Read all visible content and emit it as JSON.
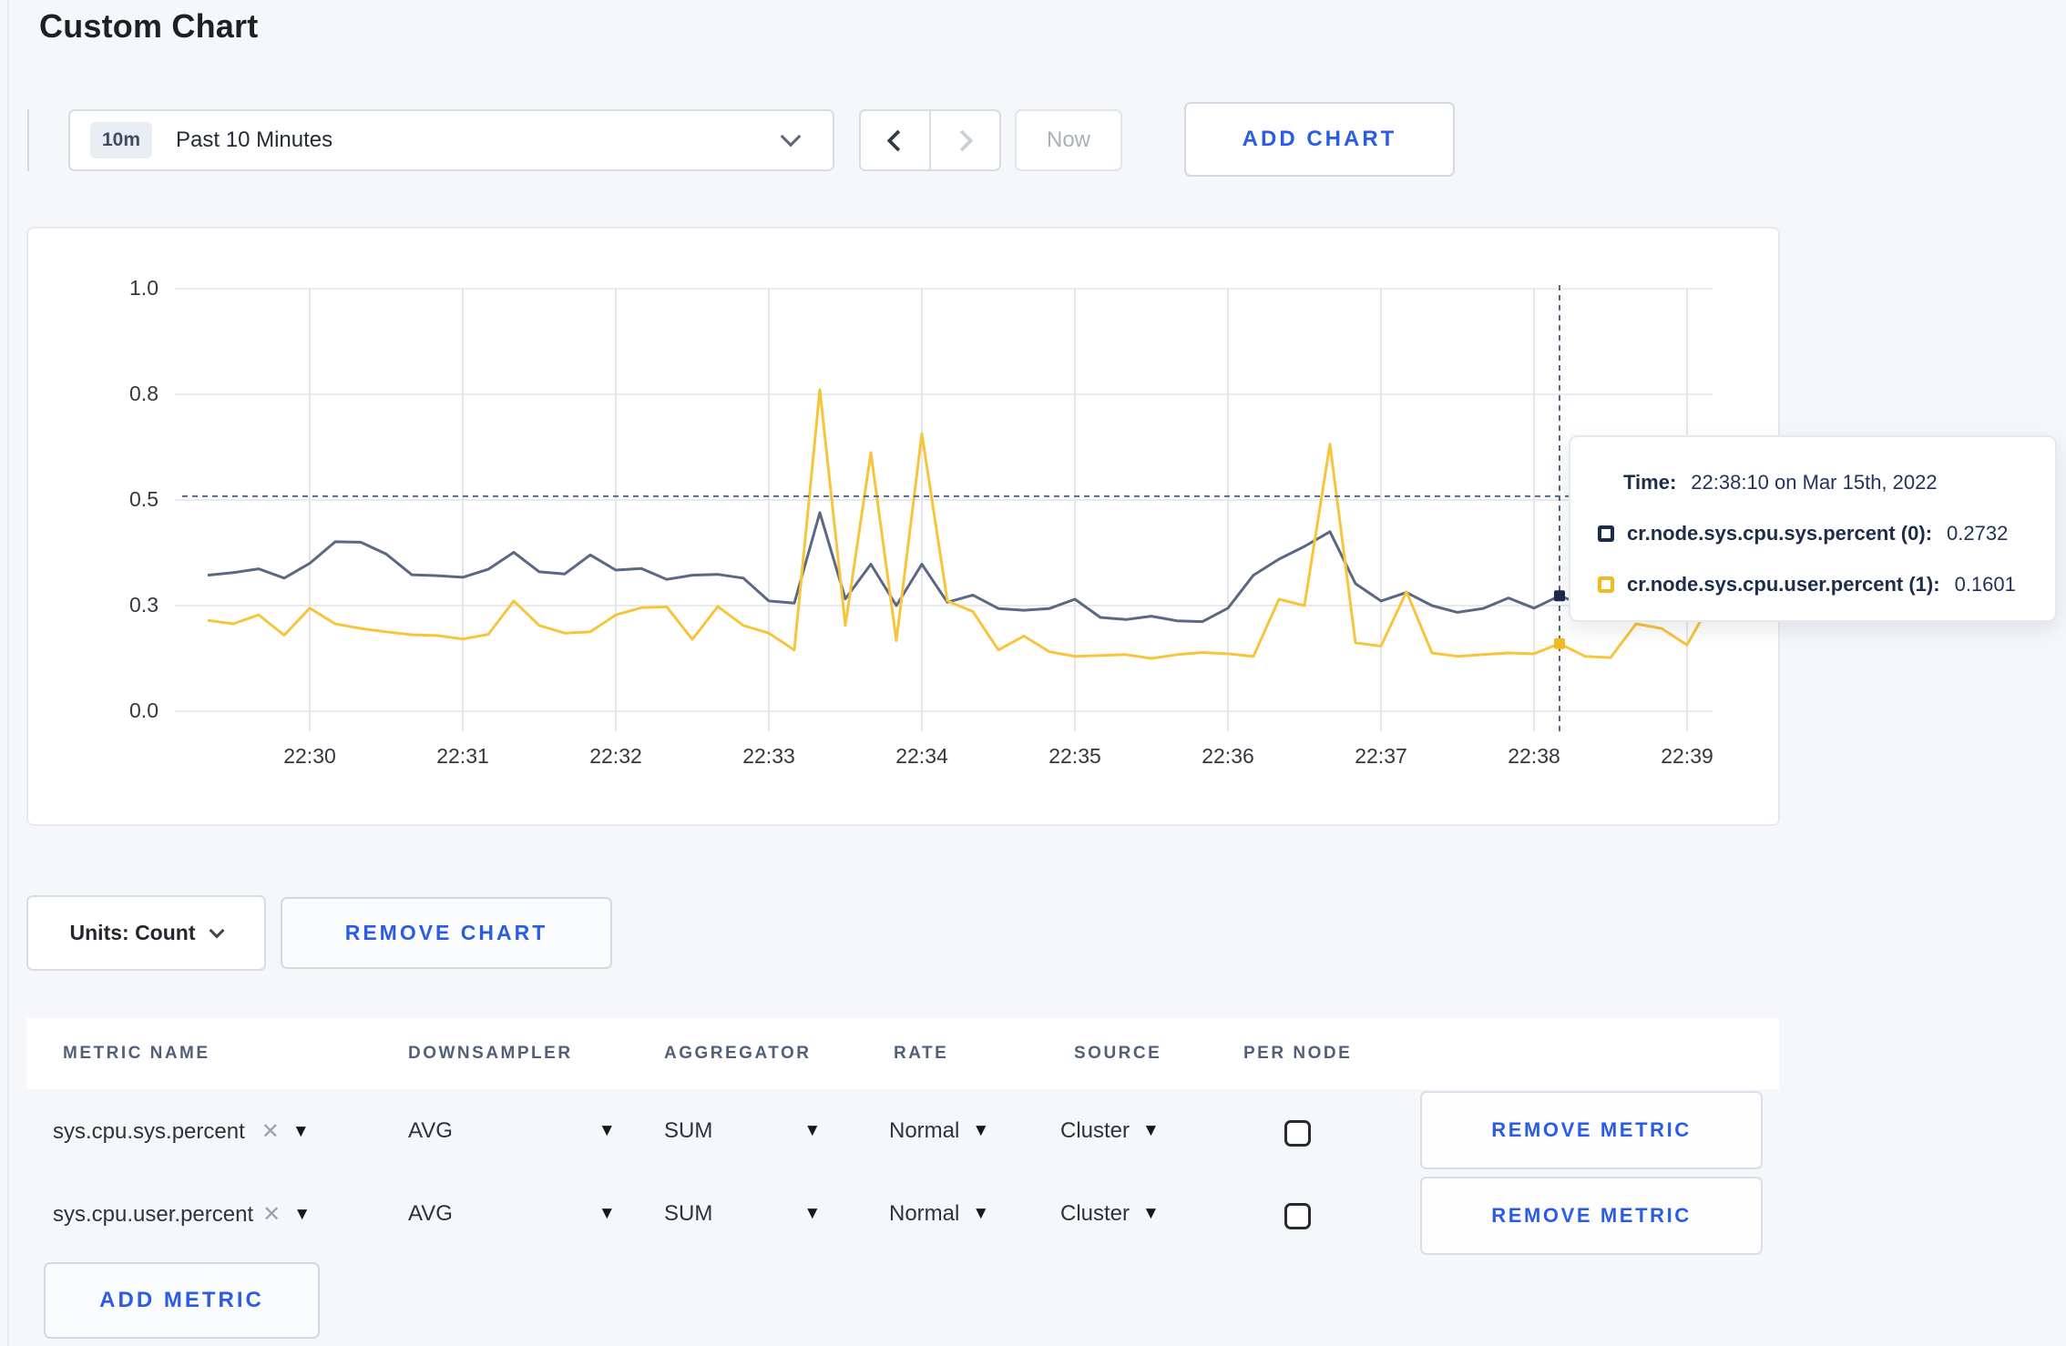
{
  "page": {
    "title": "Custom Chart",
    "background": "#f5f7fa",
    "accent_blue": "#2b5ce5"
  },
  "toolbar": {
    "time_range": {
      "badge": "10m",
      "label": "Past 10 Minutes"
    },
    "prev_icon": "chevron-left",
    "next_icon": "chevron-right",
    "now_label": "Now",
    "add_chart_label": "ADD CHART"
  },
  "tooltip": {
    "time_label": "Time:",
    "time_value": "22:38:10 on Mar 15th, 2022",
    "series": [
      {
        "label": "cr.node.sys.cpu.sys.percent (0):",
        "value": "0.2732",
        "swatch_color": "#1b2b4a"
      },
      {
        "label": "cr.node.sys.cpu.user.percent (1):",
        "value": "0.1601",
        "swatch_color": "#f3ba1f"
      }
    ]
  },
  "units_label": "Units: Count",
  "remove_chart_label": "REMOVE CHART",
  "metrics_table": {
    "columns": [
      "METRIC NAME",
      "DOWNSAMPLER",
      "AGGREGATOR",
      "RATE",
      "SOURCE",
      "PER NODE"
    ],
    "rows": [
      {
        "metric": "sys.cpu.sys.percent",
        "downsampler": "AVG",
        "aggregator": "SUM",
        "rate": "Normal",
        "source": "Cluster",
        "per_node": false
      },
      {
        "metric": "sys.cpu.user.percent",
        "downsampler": "AVG",
        "aggregator": "SUM",
        "rate": "Normal",
        "source": "Cluster",
        "per_node": false
      }
    ],
    "remove_metric_label": "REMOVE METRIC",
    "add_metric_label": "ADD METRIC"
  },
  "chart_data": {
    "type": "line",
    "title": "",
    "xlabel": "",
    "ylabel": "",
    "ylim": [
      0,
      1
    ],
    "grid": true,
    "x_start_time": "22:29:20",
    "x_interval_seconds": 10,
    "x_tick_labels": [
      "22:30",
      "22:31",
      "22:32",
      "22:33",
      "22:34",
      "22:35",
      "22:36",
      "22:37",
      "22:38",
      "22:39"
    ],
    "y_ticks": [
      {
        "value": 0,
        "label": "0.0"
      },
      {
        "value": 0.25,
        "label": "0.3"
      },
      {
        "value": 0.5,
        "label": "0.5"
      },
      {
        "value": 0.75,
        "label": "0.8"
      },
      {
        "value": 1,
        "label": "1.0"
      }
    ],
    "series": [
      {
        "name": "cr.node.sys.cpu.sys.percent",
        "color": "#5b6882",
        "values": [
          0.322,
          0.328,
          0.337,
          0.315,
          0.35,
          0.401,
          0.4,
          0.372,
          0.323,
          0.321,
          0.317,
          0.336,
          0.376,
          0.33,
          0.325,
          0.37,
          0.334,
          0.338,
          0.312,
          0.322,
          0.324,
          0.315,
          0.261,
          0.256,
          0.47,
          0.266,
          0.348,
          0.25,
          0.348,
          0.258,
          0.275,
          0.243,
          0.239,
          0.243,
          0.265,
          0.222,
          0.217,
          0.225,
          0.214,
          0.212,
          0.244,
          0.322,
          0.36,
          0.39,
          0.425,
          0.302,
          0.261,
          0.281,
          0.25,
          0.234,
          0.243,
          0.268,
          0.244,
          0.2732,
          0.25,
          0.285,
          0.302,
          0.296,
          0.299,
          0.306
        ]
      },
      {
        "name": "cr.node.sys.cpu.user.percent",
        "color": "#f7c53c",
        "values": [
          0.215,
          0.207,
          0.228,
          0.18,
          0.244,
          0.207,
          0.196,
          0.188,
          0.181,
          0.179,
          0.171,
          0.182,
          0.261,
          0.203,
          0.185,
          0.188,
          0.228,
          0.245,
          0.247,
          0.17,
          0.248,
          0.203,
          0.185,
          0.145,
          0.761,
          0.203,
          0.612,
          0.167,
          0.657,
          0.261,
          0.236,
          0.145,
          0.178,
          0.141,
          0.13,
          0.132,
          0.134,
          0.125,
          0.134,
          0.139,
          0.136,
          0.13,
          0.265,
          0.25,
          0.632,
          0.162,
          0.154,
          0.283,
          0.138,
          0.13,
          0.134,
          0.138,
          0.136,
          0.1601,
          0.13,
          0.127,
          0.207,
          0.196,
          0.157,
          0.265
        ]
      }
    ],
    "crosshair": {
      "time": "22:38:10",
      "index": 53,
      "y_value": 0.509,
      "color": "#53688a"
    },
    "highlight_points": [
      {
        "series": 0,
        "index": 53,
        "value": 0.2732
      },
      {
        "series": 1,
        "index": 53,
        "value": 0.1601
      }
    ],
    "legend_position": "tooltip"
  }
}
